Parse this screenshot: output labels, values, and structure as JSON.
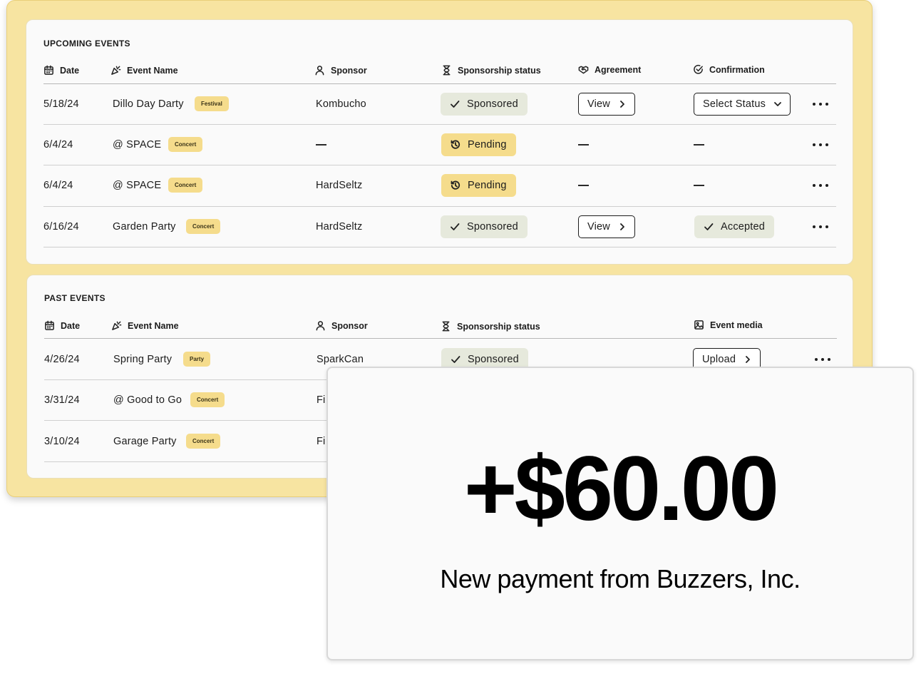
{
  "upcoming": {
    "title": "UPCOMING EVENTS",
    "headers": {
      "date": "Date",
      "event_name": "Event Name",
      "sponsor": "Sponsor",
      "status": "Sponsorship status",
      "agreement": "Agreement",
      "confirmation": "Confirmation"
    },
    "rows": [
      {
        "date": "5/18/24",
        "event": "Dillo Day Darty",
        "tag": "Festival",
        "sponsor": "Kombucho",
        "status": "Sponsored",
        "agreement": "View",
        "confirmation": "Select Status"
      },
      {
        "date": "6/4/24",
        "event": "@ SPACE",
        "tag": "Concert",
        "sponsor": "—",
        "status": "Pending",
        "agreement": "—",
        "confirmation": "—"
      },
      {
        "date": "6/4/24",
        "event": "@ SPACE",
        "tag": "Concert",
        "sponsor": "HardSeltz",
        "status": "Pending",
        "agreement": "—",
        "confirmation": "—"
      },
      {
        "date": "6/16/24",
        "event": "Garden Party",
        "tag": "Concert",
        "sponsor": "HardSeltz",
        "status": "Sponsored",
        "agreement": "View",
        "confirmation": "Accepted"
      }
    ]
  },
  "past": {
    "title": "PAST EVENTS",
    "headers": {
      "date": "Date",
      "event_name": "Event Name",
      "sponsor": "Sponsor",
      "status": "Sponsorship status",
      "media": "Event media"
    },
    "rows": [
      {
        "date": "4/26/24",
        "event": "Spring Party",
        "tag": "Party",
        "sponsor": "SparkCan",
        "status": "Sponsored",
        "media": "Upload"
      },
      {
        "date": "3/31/24",
        "event": "@ Good to Go",
        "tag": "Concert",
        "sponsor": "Fi"
      },
      {
        "date": "3/10/24",
        "event": "Garage Party",
        "tag": "Concert",
        "sponsor": "Fi"
      }
    ]
  },
  "payment": {
    "amount": "+$60.00",
    "message": "New payment from Buzzers, Inc."
  },
  "colors": {
    "frame": "#f7e4a1",
    "tag": "#f5dc8c",
    "sponsored": "#e6e9dc",
    "pending": "#f5dc8c"
  },
  "icons": {
    "date": "calendar-icon",
    "event_name": "party-popper-icon",
    "sponsor": "person-icon",
    "status": "hourglass-icon",
    "agreement": "handshake-icon",
    "confirmation": "check-circle-icon",
    "media": "image-icon",
    "sponsored": "check-icon",
    "pending": "history-icon",
    "open": "chevron-right-icon",
    "dropdown": "chevron-down-icon",
    "more": "more-horizontal-icon"
  }
}
